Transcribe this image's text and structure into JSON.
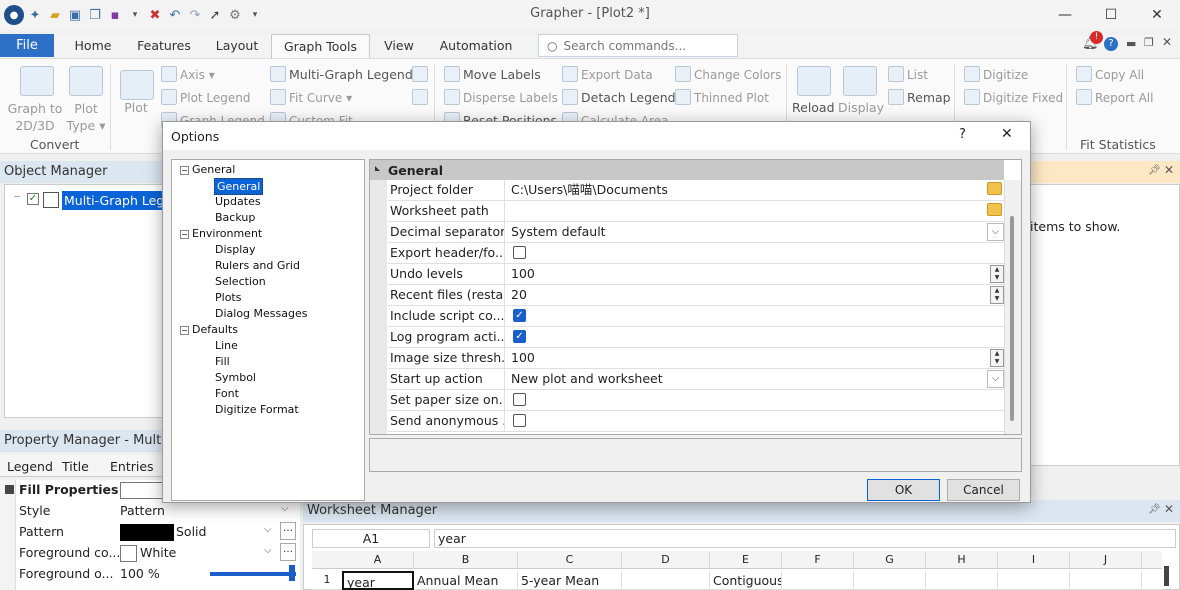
{
  "app": {
    "title": "Grapher - [Plot2 *]"
  },
  "tabs": {
    "file": "File",
    "home": "Home",
    "features": "Features",
    "layout": "Layout",
    "graph_tools": "Graph Tools",
    "view": "View",
    "automation": "Automation"
  },
  "search": {
    "placeholder": "Search commands..."
  },
  "ribbon": {
    "graph_to": "Graph to\n2D/3D",
    "graph_to_l1": "Graph to",
    "graph_to_l2": "2D/3D",
    "plot_type_l1": "Plot",
    "plot_type_l2": "Type",
    "convert_group": "Convert",
    "plot": "Plot",
    "axis": "Axis",
    "plot_legend": "Plot Legend",
    "graph_legend": "Graph Legend",
    "multi_graph_legend": "Multi-Graph Legend",
    "fit_curve": "Fit Curve",
    "custom_fit": "Custom Fit",
    "move_labels": "Move Labels",
    "disperse_labels": "Disperse Labels",
    "reset_positions": "Reset Positions",
    "export_data": "Export Data",
    "detach_legend": "Detach Legend",
    "calculate_area": "Calculate Area",
    "change_colors": "Change Colors",
    "thinned_plot": "Thinned Plot",
    "reload": "Reload",
    "display": "Display",
    "list": "List",
    "remap": "Remap",
    "digitize": "Digitize",
    "digitize_fixed": "Digitize Fixed",
    "copy_all": "Copy All",
    "report_all": "Report All",
    "fit_statistics": "Fit Statistics"
  },
  "object_manager": {
    "title": "Object Manager",
    "item": "Multi-Graph Legend",
    "info_text": "items to show."
  },
  "property_manager": {
    "title": "Property Manager - Multi-G",
    "tabs": [
      "Legend",
      "Title",
      "Entries"
    ],
    "section": "Fill Properties",
    "rows": [
      {
        "name": "Style",
        "value": "Pattern"
      },
      {
        "name": "Pattern",
        "value": "Solid"
      },
      {
        "name": "Foreground co...",
        "value": "White"
      },
      {
        "name": "Foreground o...",
        "value": "100 %"
      }
    ],
    "foreground_opacity": 1.0
  },
  "worksheet": {
    "title": "Worksheet Manager",
    "cell_ref": "A1",
    "cell_value": "year",
    "columns": [
      "A",
      "B",
      "C",
      "D",
      "E",
      "F",
      "G",
      "H",
      "I",
      "J"
    ],
    "rows": [
      {
        "num": "1",
        "cells": [
          "year",
          "Annual  Mean",
          "5-year  Mean",
          "",
          "Contiguous",
          "",
          "",
          "",
          "",
          ""
        ]
      }
    ]
  },
  "dialog": {
    "title": "Options",
    "help": "?",
    "close": "✕",
    "tree": {
      "general": "General",
      "general_children": [
        "General",
        "Updates",
        "Backup"
      ],
      "environment": "Environment",
      "environment_children": [
        "Display",
        "Rulers and Grid",
        "Selection",
        "Plots",
        "Dialog Messages"
      ],
      "defaults": "Defaults",
      "defaults_children": [
        "Line",
        "Fill",
        "Symbol",
        "Font",
        "Digitize Format"
      ]
    },
    "section": "General",
    "props": [
      {
        "name": "Project folder",
        "value": "C:\\Users\\喵喵\\Documents"
      },
      {
        "name": "Worksheet path",
        "value": ""
      },
      {
        "name": "Decimal separator",
        "value": "System default"
      },
      {
        "name": "Export header/fo...",
        "value": "",
        "checked": false
      },
      {
        "name": "Undo levels",
        "value": "100"
      },
      {
        "name": "Recent files (resta...",
        "value": "20"
      },
      {
        "name": "Include script co...",
        "value": "",
        "checked": true
      },
      {
        "name": "Log program acti...",
        "value": "",
        "checked": true
      },
      {
        "name": "Image size thresh...",
        "value": "100"
      },
      {
        "name": "Start up action",
        "value": "New plot and worksheet"
      },
      {
        "name": "Set paper size on...",
        "value": "",
        "checked": false
      },
      {
        "name": "Send anonymous ...",
        "value": "",
        "checked": false
      }
    ],
    "ok": "OK",
    "cancel": "Cancel"
  },
  "colors": {
    "accent": "#2b6fc6",
    "selection": "#0a64d8",
    "panel_header": "#dce6f1"
  }
}
